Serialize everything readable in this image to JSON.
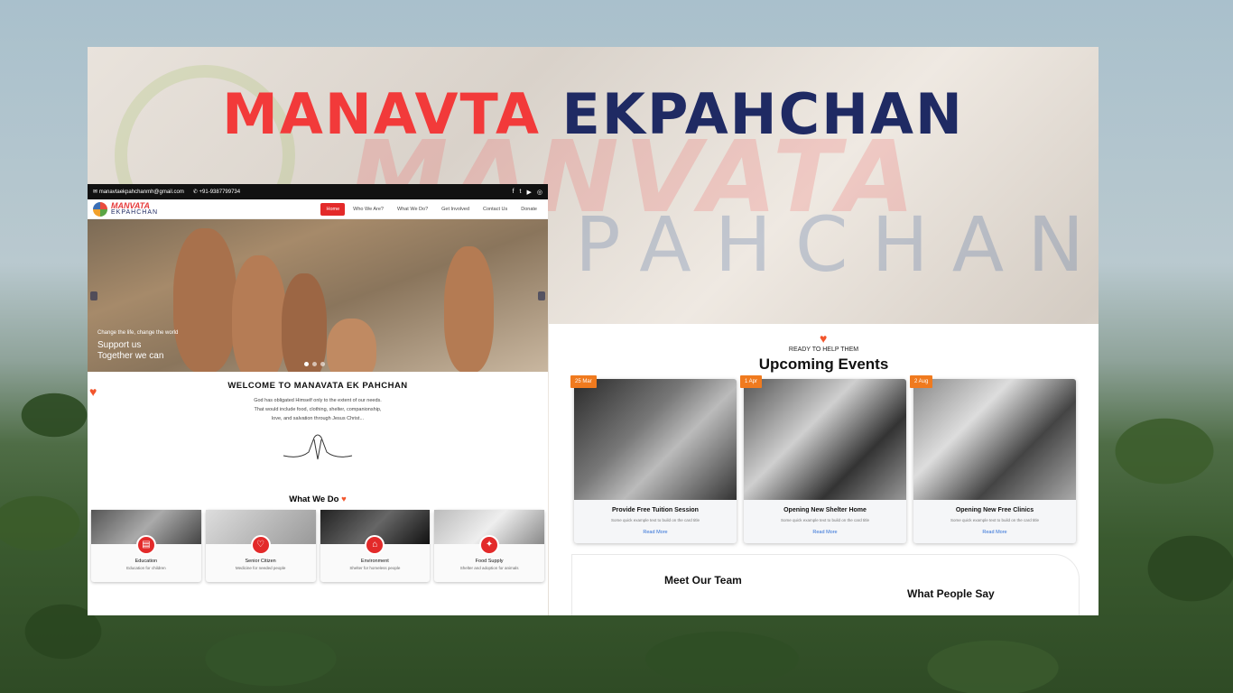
{
  "banner": {
    "title_red": "MANAVTA",
    "title_navy": "EKPAHCHAN",
    "ghost_red": "MANVATA",
    "ghost_blue": "PAHCHAN"
  },
  "left": {
    "topbar": {
      "email": "manavtaekpahchanmh@gmail.com",
      "phone": "+91-9387799734",
      "social_icons": [
        "facebook-icon",
        "twitter-icon",
        "youtube-icon",
        "instagram-icon"
      ]
    },
    "logo": {
      "line1": "MANVATA",
      "line2": "EKPAHCHAN"
    },
    "menu": [
      "Home",
      "Who We Are?",
      "What We Do?",
      "Get Involved",
      "Contact Us",
      "Donate"
    ],
    "hero": {
      "caption_small": "Change the life, change the world",
      "caption_line1": "Support us",
      "caption_line2": "Together we can"
    },
    "welcome": {
      "title": "WELCOME TO MANAVATA EK PAHCHAN",
      "line1": "God has obligated Himself only to the extent of our needs.",
      "line2": "That would include food, clothing, shelter, companionship,",
      "line3": "love, and salvation through Jesus Christ..."
    },
    "what_we_do": "What We Do",
    "services": [
      {
        "title": "Education",
        "sub": "Education for children",
        "icon": "book-icon"
      },
      {
        "title": "Senior Citizen",
        "sub": "Medicine for needed people",
        "icon": "stethoscope-icon"
      },
      {
        "title": "Environment",
        "sub": "Shelter for homeless people",
        "icon": "home-heart-icon"
      },
      {
        "title": "Food Supply",
        "sub": "Shelter and adoption for animals",
        "icon": "dog-icon"
      }
    ]
  },
  "right": {
    "ready": "READY TO HELP THEM",
    "heading": "Upcoming Events",
    "events": [
      {
        "date": "25 Mar",
        "title": "Provide Free Tuition Session",
        "sub": "Some quick example text to build on the card title",
        "link": "Read More"
      },
      {
        "date": "1 Apr",
        "title": "Opening New Shelter Home",
        "sub": "Some quick example text to build on the card title",
        "link": "Read More"
      },
      {
        "date": "2 Aug",
        "title": "Opening New Free Clinics",
        "sub": "Some quick example text to build on the card title",
        "link": "Read More"
      }
    ],
    "meet_team": "Meet Our Team",
    "what_people_say": "What People Say"
  },
  "colors": {
    "brand_red": "#f23a3a",
    "brand_navy": "#1f2a63",
    "event_badge": "#f07a1e",
    "link_blue": "#2f6fd6"
  }
}
